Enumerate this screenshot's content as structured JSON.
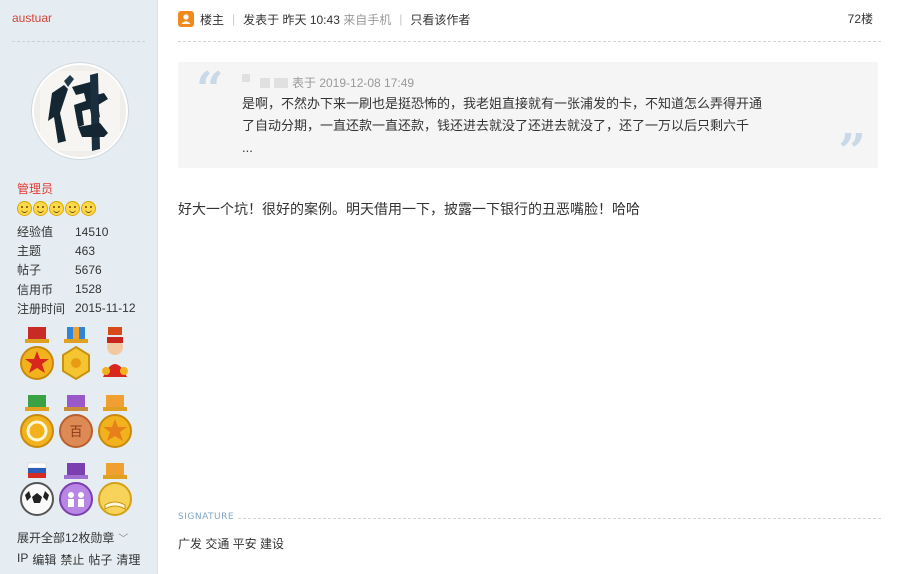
{
  "author": {
    "username": "austuar",
    "role": "管理员",
    "star_count": 5,
    "stats": [
      {
        "label": "经验值",
        "value": "14510"
      },
      {
        "label": "主题",
        "value": "463"
      },
      {
        "label": "帖子",
        "value": "5676"
      },
      {
        "label": "信用币",
        "value": "1528"
      },
      {
        "label": "注册时间",
        "value": "2015-11-12"
      }
    ],
    "medal_count": 9,
    "expand_medals": "展开全部12枚勋章",
    "admin_links": [
      "IP",
      "编辑",
      "禁止",
      "帖子",
      "清理"
    ]
  },
  "post": {
    "op_label": "楼主",
    "posted_prefix": "发表于",
    "posted_time": "昨天 10:43",
    "posted_from": "来自手机",
    "only_author": "只看该作者",
    "floor": "72楼",
    "quote": {
      "meta": "表于 2019-12-08 17:49",
      "lines": [
        "是啊，不然办下来一刷也是挺恐怖的，我老姐直接就有一张浦发的卡，不知道怎么弄得开通",
        "了自动分期，一直还款一直还款，钱还进去就没了还进去就没了，还了一万以后只剩六千",
        "..."
      ]
    },
    "body": "好大一个坑！很好的案例。明天借用一下，披露一下银行的丑恶嘴脸！哈哈",
    "signature_label": "SIGNATURE",
    "signature": "广发 交通 平安 建设"
  },
  "colors": {
    "sidebar_bg": "#e5edf2",
    "username": "#d0473a",
    "role": "#e33b2e",
    "op_icon": "#f08a1c",
    "quote_bg": "#f5f5f5",
    "signature_label": "#7fa6c4"
  }
}
